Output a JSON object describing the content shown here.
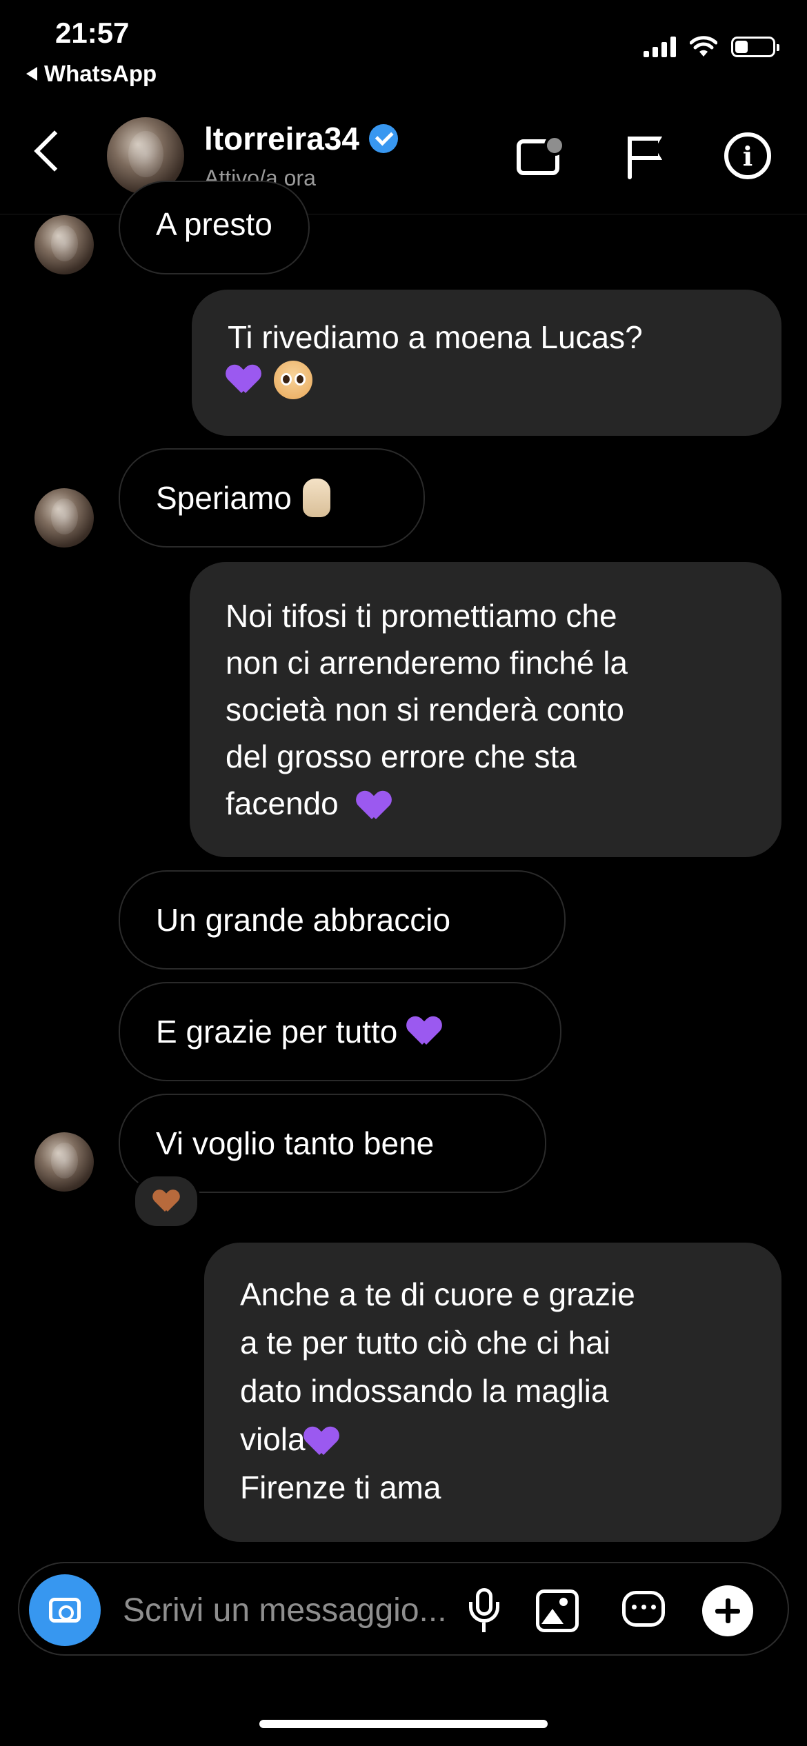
{
  "status_bar": {
    "time": "21:57",
    "back_app": "WhatsApp",
    "signal_bars": 4,
    "battery_level": 0.35
  },
  "header": {
    "username": "ltorreira34",
    "verified": true,
    "status": "Attivo/a ora",
    "icons": [
      "back-icon",
      "video-call-icon",
      "flag-icon",
      "info-icon"
    ]
  },
  "messages": [
    {
      "direction": "received",
      "text": "A presto",
      "avatar": true
    },
    {
      "direction": "sent",
      "lines": [
        "Ti rivediamo a moena Lucas?"
      ],
      "emoji": [
        "purple-heart",
        "pleading-face"
      ]
    },
    {
      "direction": "received",
      "text": "Speriamo",
      "emoji": [
        "crossed-fingers"
      ],
      "avatar": true
    },
    {
      "direction": "sent",
      "lines": [
        "Noi tifosi ti promettiamo che",
        "non ci arrenderemo finché la",
        "società non si renderà conto",
        "del grosso errore che sta",
        "facendo"
      ],
      "emoji": [
        "purple-heart"
      ]
    },
    {
      "direction": "received",
      "text": "Un grande abbraccio"
    },
    {
      "direction": "received",
      "text": "E grazie per tutto",
      "emoji": [
        "purple-heart"
      ]
    },
    {
      "direction": "received",
      "text": "Vi voglio tanto bene",
      "avatar": true,
      "reaction": "brown-heart"
    },
    {
      "direction": "sent",
      "lines": [
        "Anche a te di cuore e grazie",
        "a te per tutto ciò che ci hai",
        "dato indossando la maglia",
        "viola",
        "Firenze ti ama"
      ],
      "emoji": [
        "purple-heart"
      ]
    }
  ],
  "composer": {
    "placeholder": "Scrivi un messaggio...",
    "icons": [
      "camera-icon",
      "microphone-icon",
      "image-icon",
      "sticker-icon",
      "plus-icon"
    ]
  },
  "colors": {
    "background": "#000000",
    "sent_bubble": "#262626",
    "received_border": "#2a2a2a",
    "accent_blue": "#3797f0",
    "verified_blue": "#3897f0",
    "purple_heart": "#9b59f0",
    "muted_text": "#9a9a9a"
  }
}
